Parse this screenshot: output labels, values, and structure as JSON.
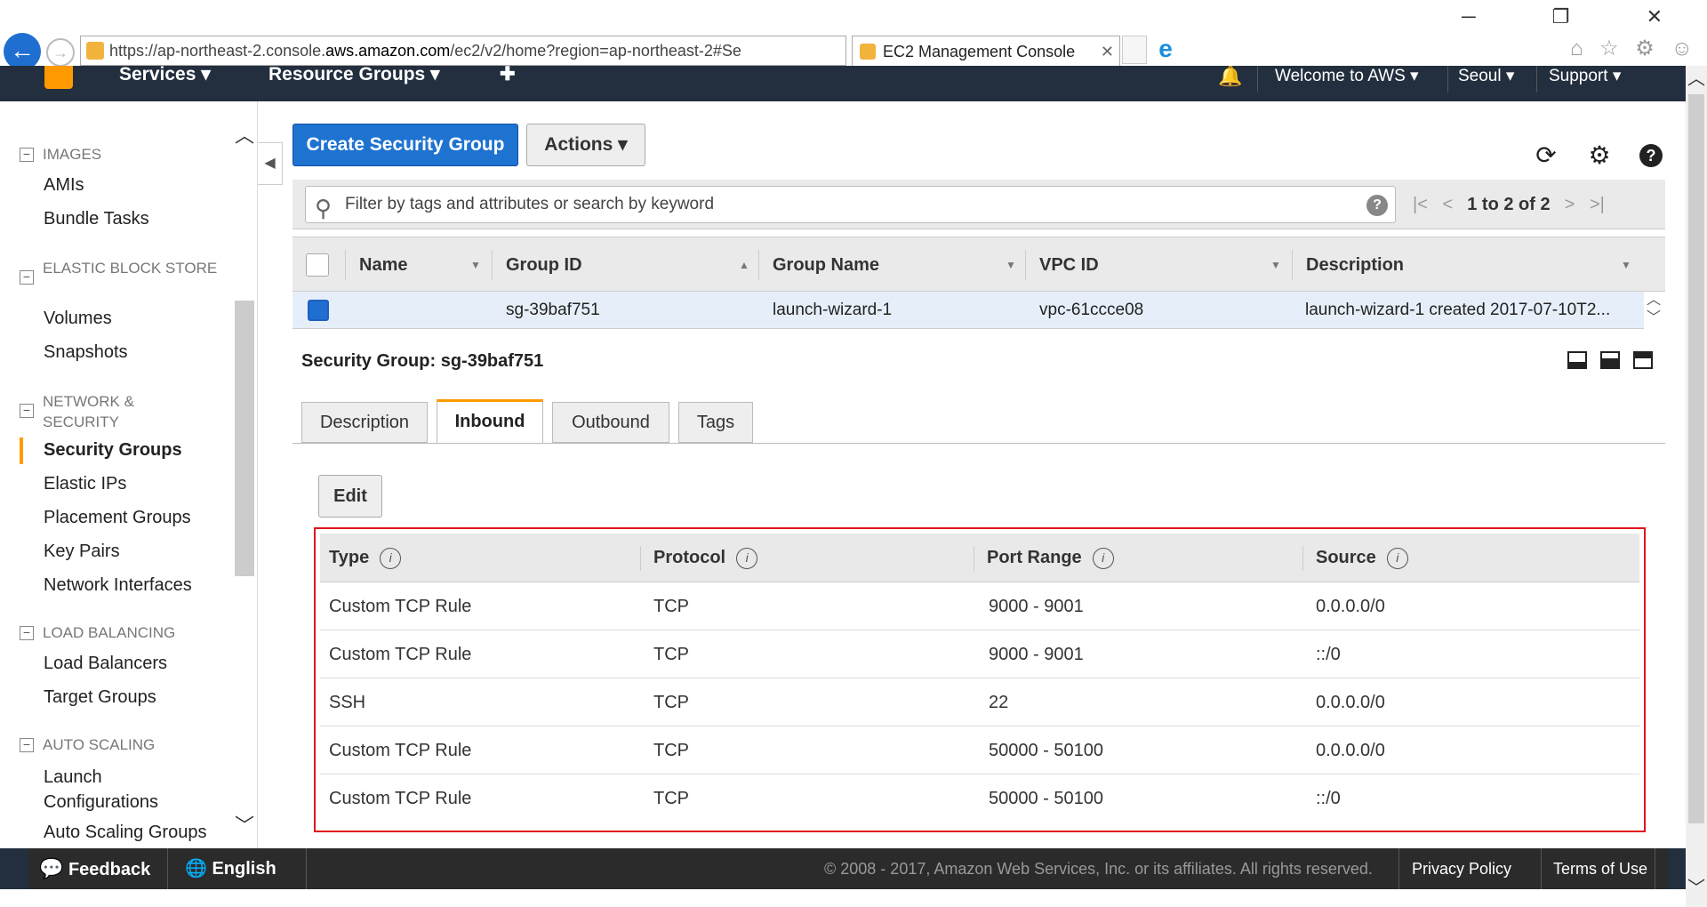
{
  "browser": {
    "url_prefix": "https://ap-northeast-2.console.",
    "url_domain": "aws.amazon.com",
    "url_rest": "/ec2/v2/home?region=ap-northeast-2#Se",
    "addr_tools": "⚲ ▾ 🔒 ↻",
    "tab_title": "EC2 Management Console",
    "tab_close": "✕",
    "window_controls": "─ ❐ ✕"
  },
  "nav": {
    "services": "Services ▾",
    "resource_groups": "Resource Groups ▾",
    "pin": "✚",
    "bell": "🔔",
    "welcome": "Welcome to AWS ▾",
    "region": "Seoul ▾",
    "support": "Support ▾"
  },
  "sidebar": {
    "sections": [
      {
        "title": "IMAGES",
        "items": [
          "AMIs",
          "Bundle Tasks"
        ]
      },
      {
        "title": "ELASTIC BLOCK STORE",
        "items": [
          "Volumes",
          "Snapshots"
        ]
      },
      {
        "title": "NETWORK & SECURITY",
        "items": [
          "Security Groups",
          "Elastic IPs",
          "Placement Groups",
          "Key Pairs",
          "Network Interfaces"
        ]
      },
      {
        "title": "LOAD BALANCING",
        "items": [
          "Load Balancers",
          "Target Groups"
        ]
      },
      {
        "title": "AUTO SCALING",
        "items": [
          "Launch Configurations",
          "Auto Scaling Groups"
        ]
      }
    ],
    "active": "Security Groups"
  },
  "toolbar": {
    "create_label": "Create Security Group",
    "actions_label": "Actions ▾"
  },
  "filter": {
    "placeholder": "Filter by tags and attributes or search by keyword",
    "pager_text": "1 to 2 of 2"
  },
  "grid": {
    "columns": [
      "Name",
      "Group ID",
      "Group Name",
      "VPC ID",
      "Description"
    ],
    "rows": [
      {
        "name": "",
        "group_id": "sg-39baf751",
        "group_name": "launch-wizard-1",
        "vpc_id": "vpc-61ccce08",
        "description": "launch-wizard-1 created 2017-07-10T2..."
      }
    ]
  },
  "detail": {
    "title": "Security Group: sg-39baf751",
    "tabs": [
      "Description",
      "Inbound",
      "Outbound",
      "Tags"
    ],
    "active_tab": "Inbound",
    "edit_label": "Edit",
    "rule_columns": [
      "Type",
      "Protocol",
      "Port Range",
      "Source"
    ],
    "rules": [
      {
        "type": "Custom TCP Rule",
        "protocol": "TCP",
        "port_range": "9000 - 9001",
        "source": "0.0.0.0/0"
      },
      {
        "type": "Custom TCP Rule",
        "protocol": "TCP",
        "port_range": "9000 - 9001",
        "source": "::/0"
      },
      {
        "type": "SSH",
        "protocol": "TCP",
        "port_range": "22",
        "source": "0.0.0.0/0"
      },
      {
        "type": "Custom TCP Rule",
        "protocol": "TCP",
        "port_range": "50000 - 50100",
        "source": "0.0.0.0/0"
      },
      {
        "type": "Custom TCP Rule",
        "protocol": "TCP",
        "port_range": "50000 - 50100",
        "source": "::/0"
      }
    ]
  },
  "footer": {
    "feedback": "Feedback",
    "language": "English",
    "copyright": "© 2008 - 2017, Amazon Web Services, Inc. or its affiliates. All rights reserved.",
    "privacy": "Privacy Policy",
    "terms": "Terms of Use"
  },
  "colors": {
    "accent": "#f90",
    "primary_button": "#1e73d1",
    "highlight_border": "#e0141e",
    "nav_bg": "#232f3e"
  }
}
